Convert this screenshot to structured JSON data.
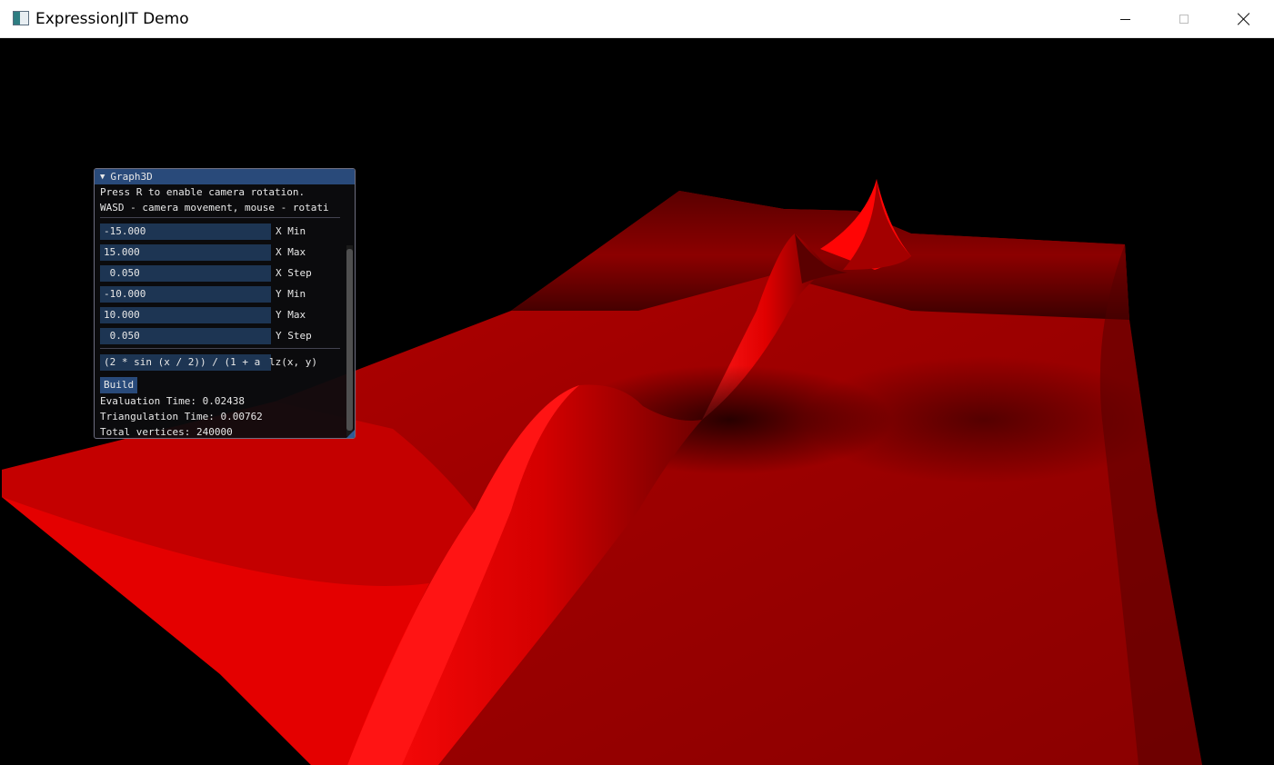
{
  "window": {
    "title": "ExpressionJIT Demo",
    "controls": {
      "minimize": "minimize",
      "maximize": "maximize",
      "close": "close"
    }
  },
  "colors": {
    "surface": "#e00000",
    "panel_header": "#294a7a",
    "field_bg": "#1d3553"
  },
  "panel": {
    "title": "Graph3D",
    "collapse_glyph": "▼",
    "help_line_1": "Press R to enable camera rotation.",
    "help_line_2": "WASD - camera movement, mouse - rotati",
    "fields": [
      {
        "value": "-15.000",
        "label": "X Min"
      },
      {
        "value": "15.000",
        "label": "X Max"
      },
      {
        "value": " 0.050",
        "label": "X Step"
      },
      {
        "value": "-10.000",
        "label": "Y Min"
      },
      {
        "value": "10.000",
        "label": "Y Max"
      },
      {
        "value": " 0.050",
        "label": "Y Step"
      }
    ],
    "expression_value": "(2 * sin (x / 2)) / (1 + a",
    "expression_label": "lz(x, y)",
    "build_label": "Build",
    "eval_time": "Evaluation Time:  0.02438",
    "tri_time": "Triangulation Time:  0.00762",
    "vertices": "Total vertices: 240000"
  }
}
